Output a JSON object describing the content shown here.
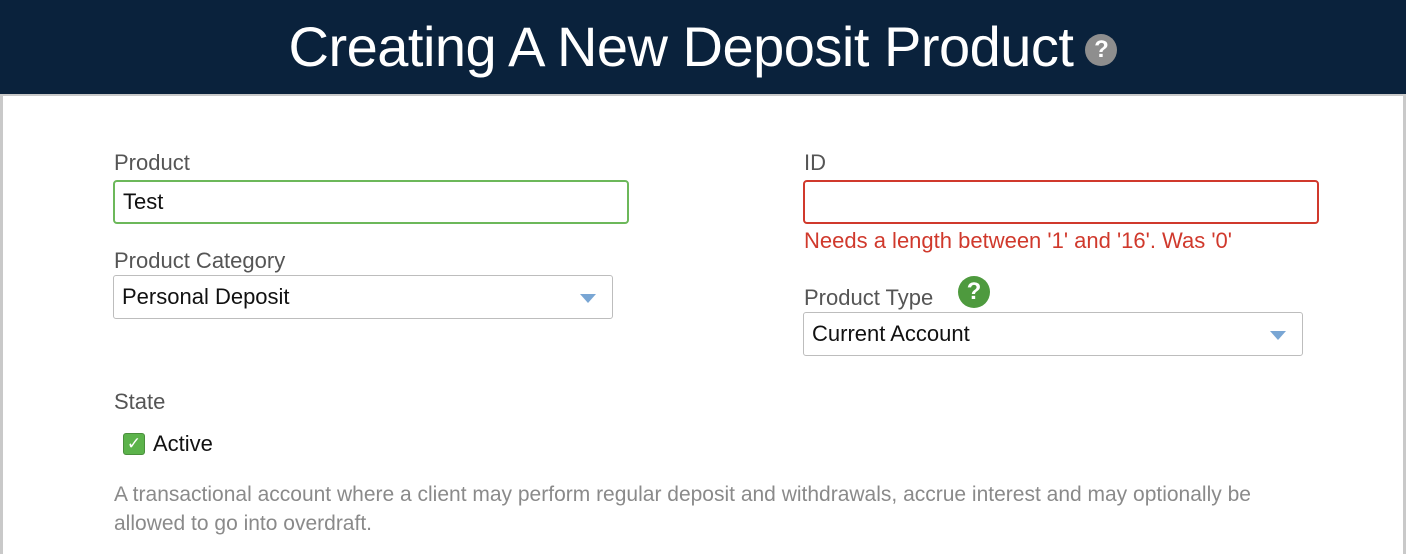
{
  "header": {
    "title": "Creating A New Deposit Product",
    "help_icon": "question-icon",
    "background": "#0a223c"
  },
  "form": {
    "product": {
      "label": "Product",
      "value": "Test"
    },
    "id": {
      "label": "ID",
      "value": "",
      "error": "Needs a length between '1' and '16'. Was '0'"
    },
    "product_category": {
      "label": "Product Category",
      "selected": "Personal Deposit"
    },
    "product_type": {
      "label": "Product Type",
      "selected": "Current Account",
      "help_icon": "question-icon"
    },
    "state": {
      "label": "State",
      "checkbox_label": "Active",
      "checked": true
    },
    "description": "A transactional account where a client may perform regular deposit and withdrawals, accrue interest and may optionally be allowed to go into overdraft."
  },
  "colors": {
    "valid_border": "#6cb85a",
    "error": "#d0392c",
    "help_green": "#4e9a3e",
    "caret": "#79a6d4"
  }
}
